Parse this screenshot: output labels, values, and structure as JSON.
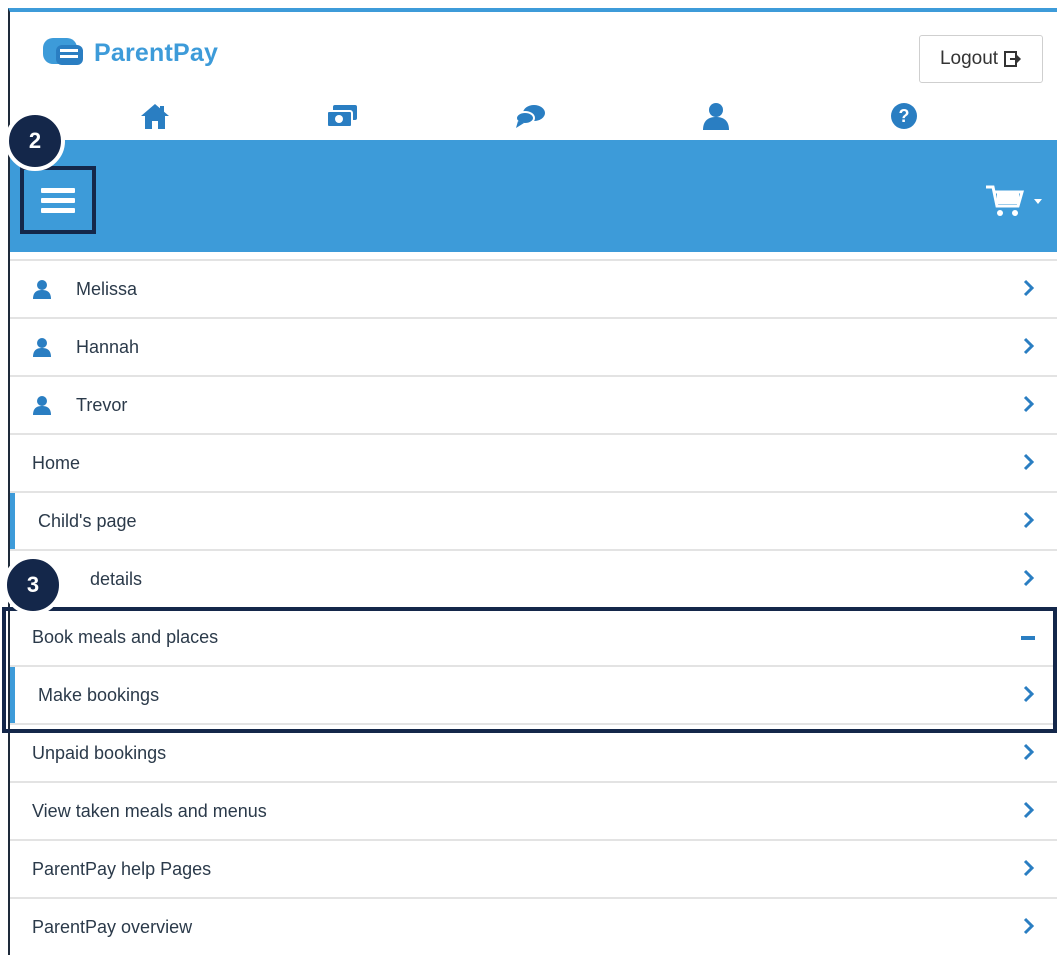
{
  "brand": {
    "name": "ParentPay"
  },
  "header": {
    "logout_label": "Logout"
  },
  "nav_icons": [
    "home-icon",
    "payments-icon",
    "messages-icon",
    "profile-icon",
    "help-icon"
  ],
  "menu": {
    "children": [
      "Melissa",
      "Hannah",
      "Trevor"
    ],
    "home": "Home",
    "childs_page": "Child's page",
    "details": "details",
    "book_meals": "Book meals and places",
    "make_bookings": "Make bookings",
    "unpaid_bookings": "Unpaid bookings",
    "view_meals": "View taken meals and menus",
    "help_pages": "ParentPay help Pages",
    "overview": "ParentPay overview"
  },
  "annotations": {
    "step2": "2",
    "step3": "3"
  },
  "colors": {
    "accent": "#3d9bd9",
    "badge": "#14274a",
    "text": "#2b3a4a"
  }
}
